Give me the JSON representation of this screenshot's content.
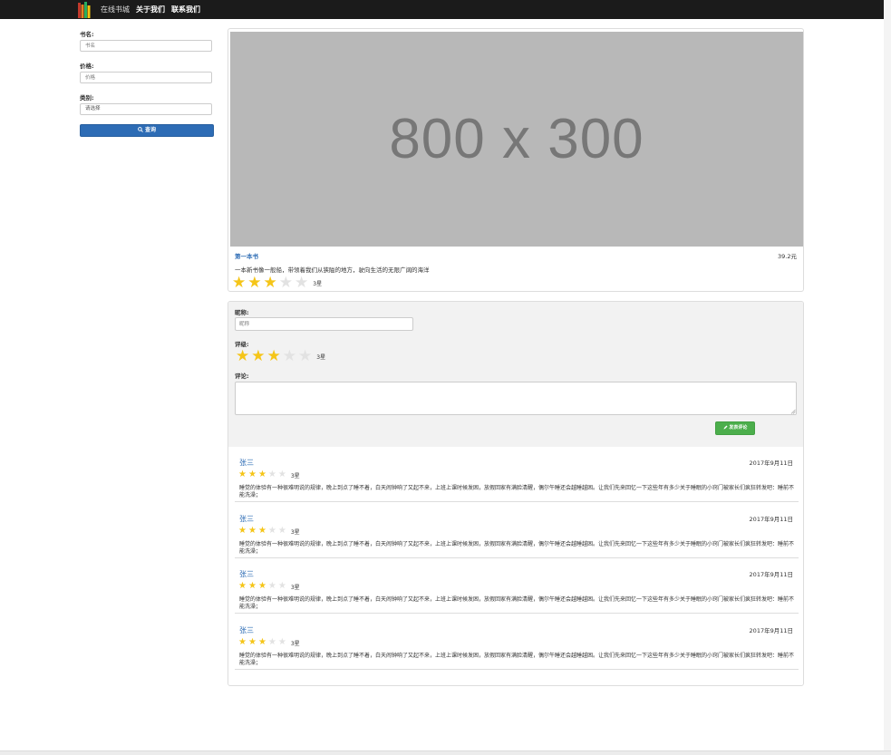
{
  "navbar": {
    "brand": "在线书城",
    "about": "关于我们",
    "contact": "联系我们"
  },
  "sidebar": {
    "name_label": "书名:",
    "name_placeholder": "书名",
    "price_label": "价格:",
    "price_placeholder": "价格",
    "category_label": "类别:",
    "category_selected": "请选择",
    "search_label": "查询"
  },
  "book": {
    "image_text": "800 x 300",
    "title": "第一本书",
    "price": "39.2元",
    "description": "一本新书像一般船，带领着我们从狭隘的地方，驶向生活的无限广阔的海洋",
    "rating": 3,
    "max_rating": 5,
    "rating_text": "3星"
  },
  "comment_form": {
    "nickname_label": "昵称:",
    "nickname_placeholder": "昵称",
    "rating_label": "评级:",
    "rating": 3,
    "rating_text": "3星",
    "comment_label": "评论:",
    "submit_label": "发表评论"
  },
  "comments": [
    {
      "author": "张三",
      "date": "2017年9月11日",
      "rating": 3,
      "rating_text": "3星",
      "text": "睡觉的体验有一种很难明说的规律，晚上到点了睡不着，白天闹钟响了又起不来，上班上课时候发困，放假回家有满脸清醒，偶尔午睡还会越睡越困。让我们先来回忆一下这些年有多少关于睡眠的小窍门被家长们疯狂转发吧：睡前不能洗澡；"
    },
    {
      "author": "张三",
      "date": "2017年9月11日",
      "rating": 3,
      "rating_text": "3星",
      "text": "睡觉的体验有一种很难明说的规律，晚上到点了睡不着，白天闹钟响了又起不来，上班上课时候发困，放假回家有满脸清醒，偶尔午睡还会越睡越困。让我们先来回忆一下这些年有多少关于睡眠的小窍门被家长们疯狂转发吧：睡前不能洗澡；"
    },
    {
      "author": "张三",
      "date": "2017年9月11日",
      "rating": 3,
      "rating_text": "3星",
      "text": "睡觉的体验有一种很难明说的规律，晚上到点了睡不着，白天闹钟响了又起不来，上班上课时候发困，放假回家有满脸清醒，偶尔午睡还会越睡越困。让我们先来回忆一下这些年有多少关于睡眠的小窍门被家长们疯狂转发吧：睡前不能洗澡；"
    },
    {
      "author": "张三",
      "date": "2017年9月11日",
      "rating": 3,
      "rating_text": "3星",
      "text": "睡觉的体验有一种很难明说的规律，晚上到点了睡不着，白天闹钟响了又起不来，上班上课时候发困，放假回家有满脸清醒，偶尔午睡还会越睡越困。让我们先来回忆一下这些年有多少关于睡眠的小窍门被家长们疯狂转发吧：睡前不能洗澡；"
    }
  ],
  "colors": {
    "navbar": "#1b1b1b",
    "primary": "#2d6cb5",
    "success": "#4cae4c",
    "star_on": "#f5c518",
    "star_off": "#e2e2e2"
  },
  "icons": {
    "logo": "books-logo-icon",
    "search": "search-icon",
    "submit": "pencil-icon"
  }
}
